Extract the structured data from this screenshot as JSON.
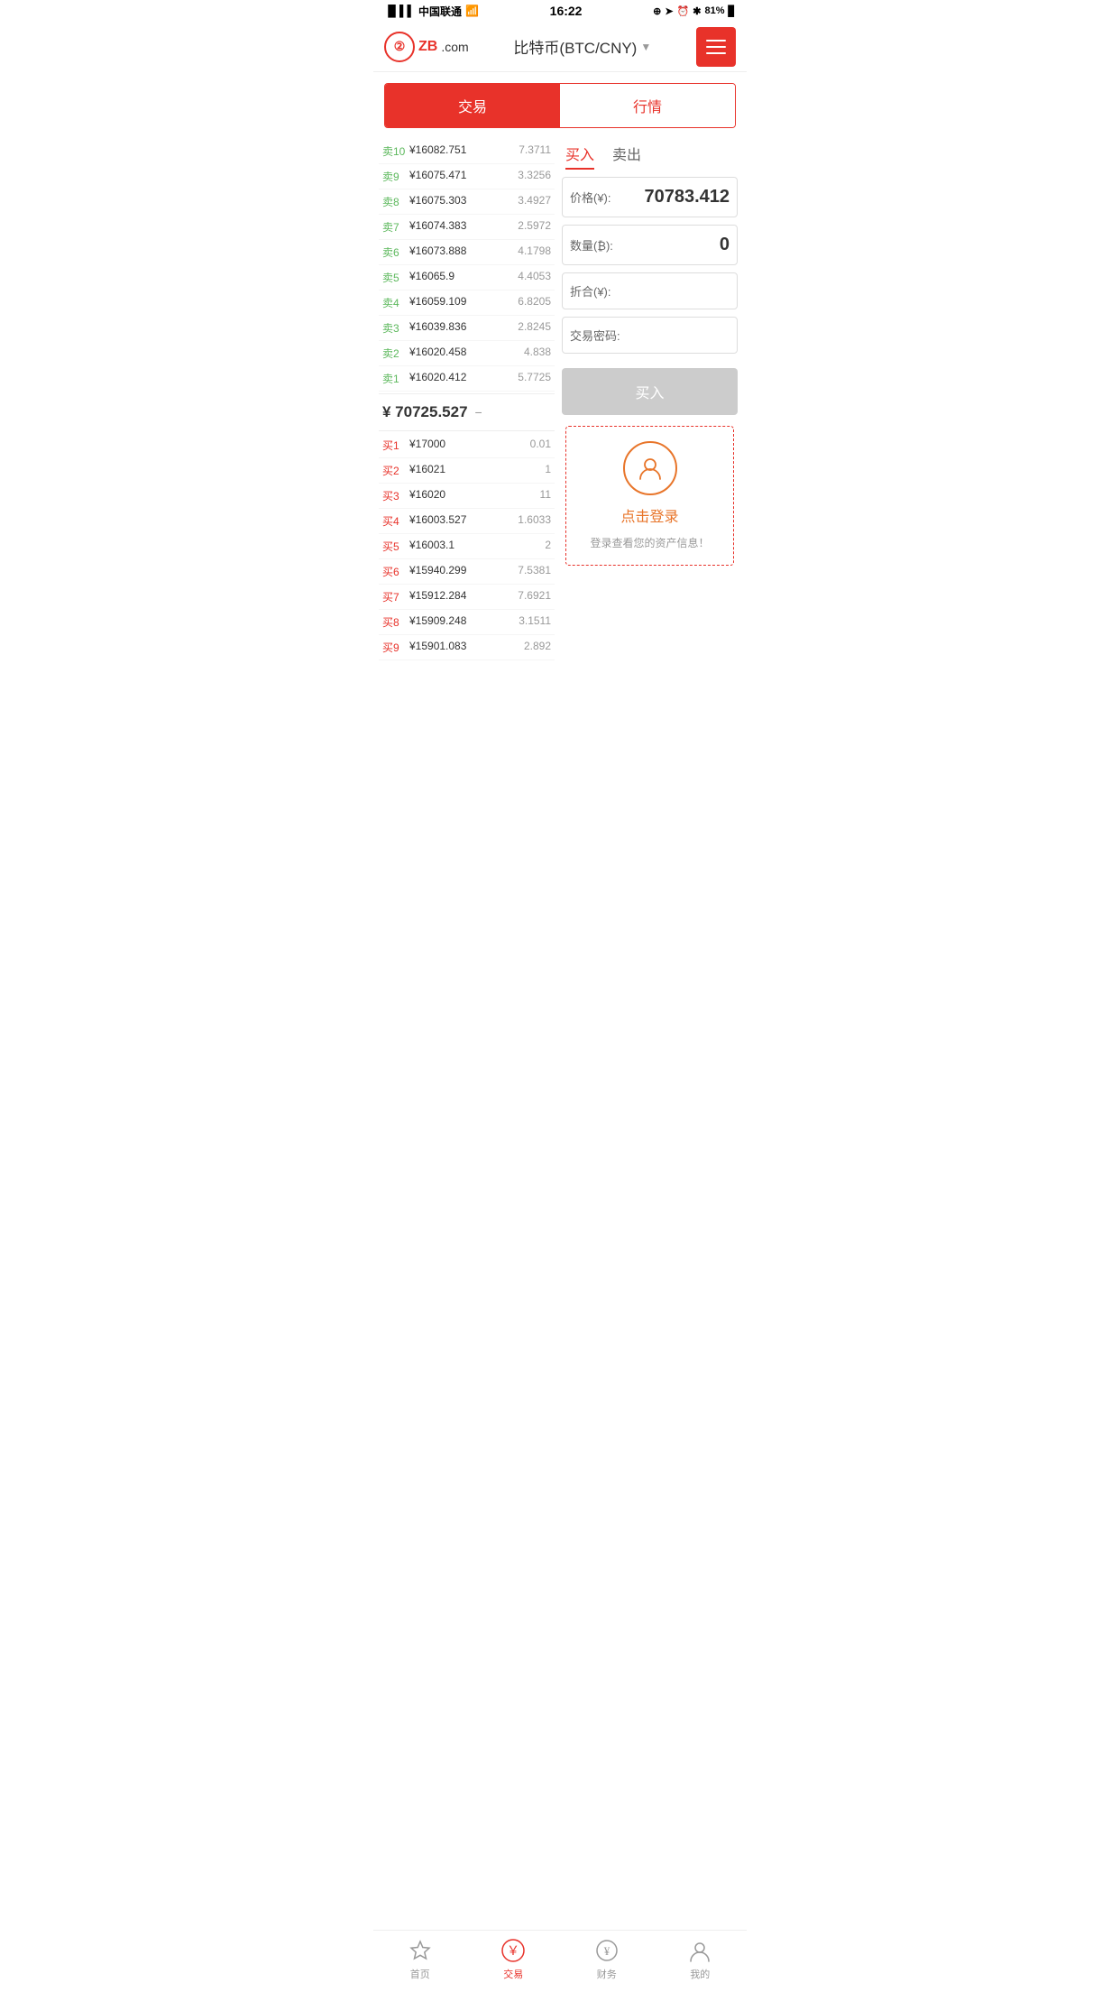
{
  "statusBar": {
    "carrier": "中国联通",
    "time": "16:22",
    "battery": "81%"
  },
  "header": {
    "logoText": "ZB",
    "logoDomain": ".com",
    "title": "比特币(BTC/CNY)",
    "menuLabel": "menu"
  },
  "tabs": {
    "trade": "交易",
    "market": "行情"
  },
  "orderBook": {
    "sells": [
      {
        "label": "卖10",
        "price": "¥16082.751",
        "qty": "7.3711"
      },
      {
        "label": "卖9",
        "price": "¥16075.471",
        "qty": "3.3256"
      },
      {
        "label": "卖8",
        "price": "¥16075.303",
        "qty": "3.4927"
      },
      {
        "label": "卖7",
        "price": "¥16074.383",
        "qty": "2.5972"
      },
      {
        "label": "卖6",
        "price": "¥16073.888",
        "qty": "4.1798"
      },
      {
        "label": "卖5",
        "price": "¥16065.9",
        "qty": "4.4053"
      },
      {
        "label": "卖4",
        "price": "¥16059.109",
        "qty": "6.8205"
      },
      {
        "label": "卖3",
        "price": "¥16039.836",
        "qty": "2.8245"
      },
      {
        "label": "卖2",
        "price": "¥16020.458",
        "qty": "4.838"
      },
      {
        "label": "卖1",
        "price": "¥16020.412",
        "qty": "5.7725"
      }
    ],
    "currentPrice": "¥ 70725.527",
    "currentPriceIcon": "−",
    "buys": [
      {
        "label": "买1",
        "price": "¥17000",
        "qty": "0.01"
      },
      {
        "label": "买2",
        "price": "¥16021",
        "qty": "1"
      },
      {
        "label": "买3",
        "price": "¥16020",
        "qty": "11"
      },
      {
        "label": "买4",
        "price": "¥16003.527",
        "qty": "1.6033"
      },
      {
        "label": "买5",
        "price": "¥16003.1",
        "qty": "2"
      },
      {
        "label": "买6",
        "price": "¥15940.299",
        "qty": "7.5381"
      },
      {
        "label": "买7",
        "price": "¥15912.284",
        "qty": "7.6921"
      },
      {
        "label": "买8",
        "price": "¥15909.248",
        "qty": "3.1511"
      },
      {
        "label": "买9",
        "price": "¥15901.083",
        "qty": "2.892"
      }
    ]
  },
  "tradePanel": {
    "buyTab": "买入",
    "sellTab": "卖出",
    "priceLabel": "价格(¥):",
    "priceValue": "70783.412",
    "qtyLabel": "数量(₿):",
    "qtyValue": "0",
    "totalLabel": "折合(¥):",
    "totalValue": "",
    "passwordLabel": "交易密码:",
    "buyButton": "买入"
  },
  "loginBox": {
    "loginText": "点击登录",
    "subText": "登录查看您的资产信息！"
  },
  "bottomNav": [
    {
      "icon": "star",
      "label": "首页",
      "active": false
    },
    {
      "icon": "yuan",
      "label": "交易",
      "active": true
    },
    {
      "icon": "bag",
      "label": "财务",
      "active": false
    },
    {
      "icon": "user",
      "label": "我的",
      "active": false
    }
  ]
}
